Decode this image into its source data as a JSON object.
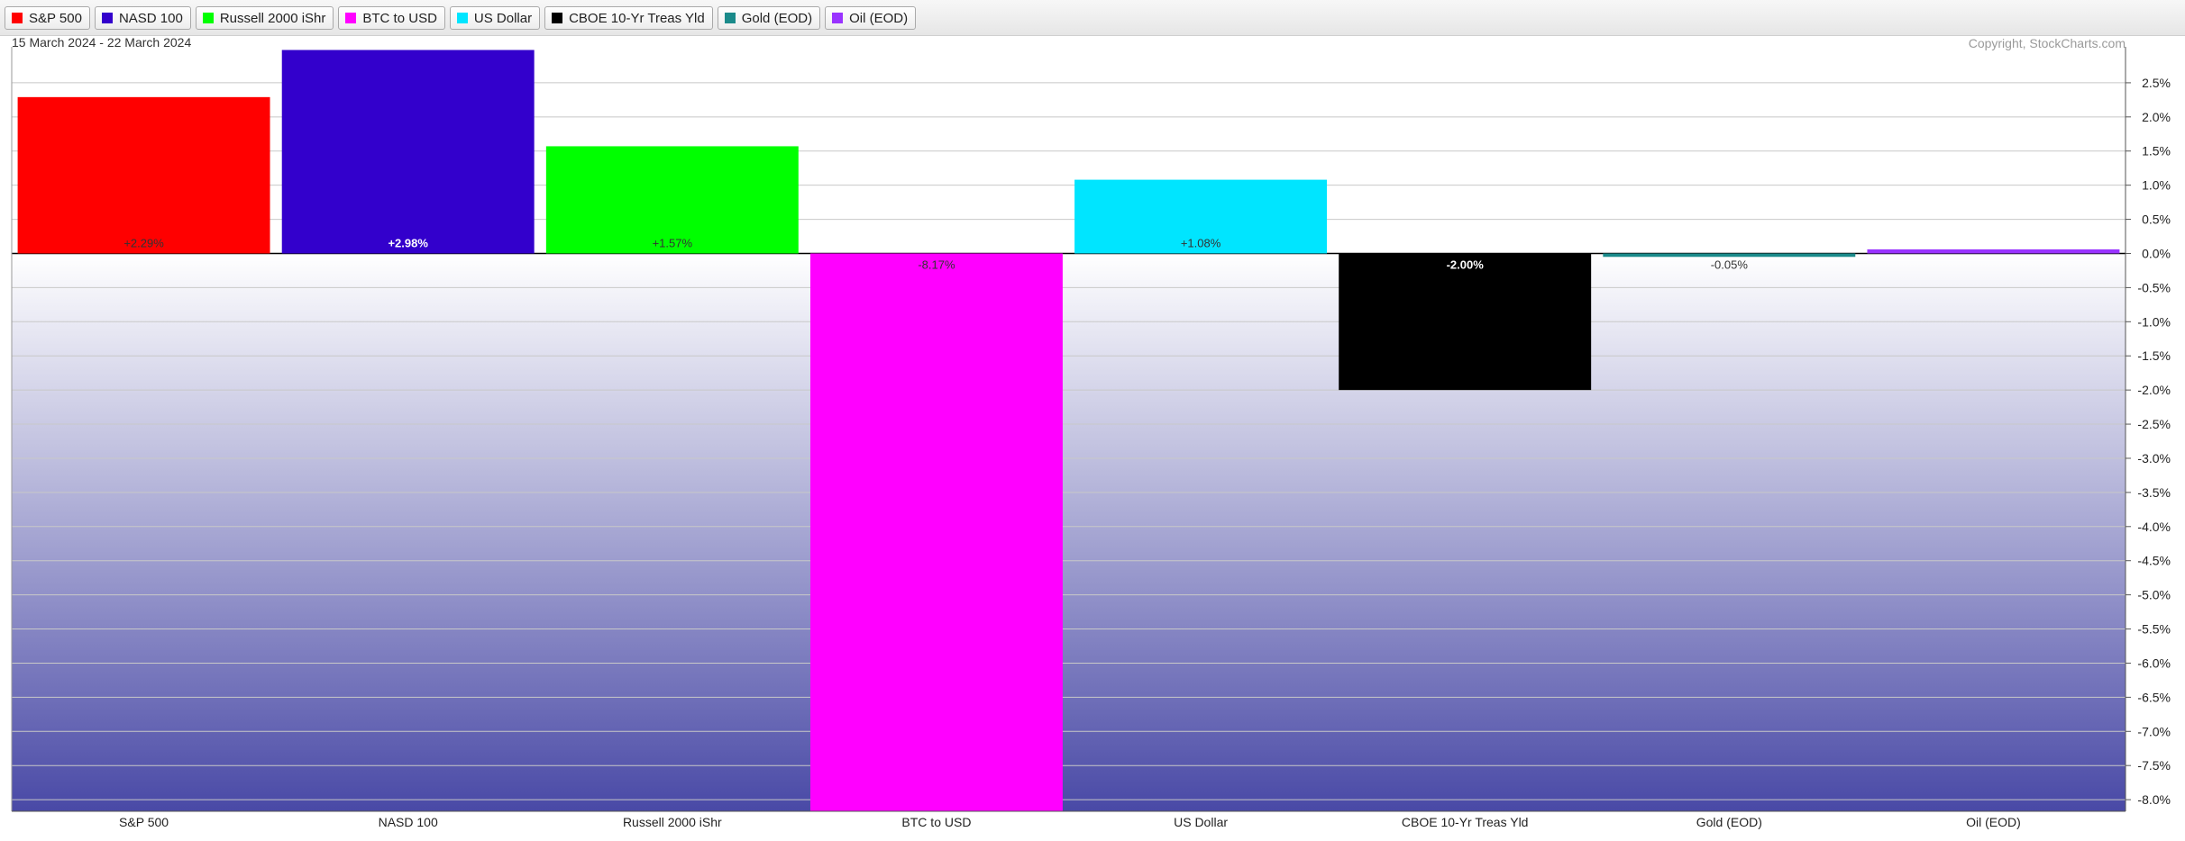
{
  "header": {
    "date_range": "15 March 2024 - 22 March 2024",
    "copyright": "Copyright, StockCharts.com"
  },
  "legend": [
    {
      "label": "S&P 500",
      "color": "#ff0000"
    },
    {
      "label": "NASD 100",
      "color": "#3300cc"
    },
    {
      "label": "Russell 2000 iShr",
      "color": "#00ff00"
    },
    {
      "label": "BTC to USD",
      "color": "#ff00ff"
    },
    {
      "label": "US Dollar",
      "color": "#00e5ff"
    },
    {
      "label": "CBOE 10-Yr Treas Yld",
      "color": "#000000"
    },
    {
      "label": "Gold (EOD)",
      "color": "#1a8a8a"
    },
    {
      "label": "Oil (EOD)",
      "color": "#9933ff"
    }
  ],
  "chart_data": {
    "type": "bar",
    "categories": [
      "S&P 500",
      "NASD 100",
      "Russell 2000 iShr",
      "BTC to USD",
      "US Dollar",
      "CBOE 10-Yr Treas Yld",
      "Gold (EOD)",
      "Oil (EOD)"
    ],
    "values": [
      2.29,
      2.98,
      1.57,
      -8.17,
      1.08,
      -2.0,
      -0.05,
      0.06
    ],
    "value_labels": [
      "+2.29%",
      "+2.98%",
      "+1.57%",
      "-8.17%",
      "+1.08%",
      "-2.00%",
      "-0.05%",
      ""
    ],
    "colors": [
      "#ff0000",
      "#3300cc",
      "#00ff00",
      "#ff00ff",
      "#00e5ff",
      "#000000",
      "#1a8a8a",
      "#9933ff"
    ],
    "y_ticks": [
      2.5,
      2.0,
      1.5,
      1.0,
      0.5,
      0.0,
      -0.5,
      -1.0,
      -1.5,
      -2.0,
      -2.5,
      -3.0,
      -3.5,
      -4.0,
      -4.5,
      -5.0,
      -5.5,
      -6.0,
      -6.5,
      -7.0,
      -7.5,
      -8.0
    ],
    "y_tick_labels": [
      "2.5%",
      "2.0%",
      "1.5%",
      "1.0%",
      "0.5%",
      "0.0%",
      "-0.5%",
      "-1.0%",
      "-1.5%",
      "-2.0%",
      "-2.5%",
      "-3.0%",
      "-3.5%",
      "-4.0%",
      "-4.5%",
      "-5.0%",
      "-5.5%",
      "-6.0%",
      "-6.5%",
      "-7.0%",
      "-7.5%",
      "-8.0%"
    ],
    "ylim": [
      -8.17,
      3.0
    ],
    "grid": true,
    "y_axis_side": "right",
    "legend_position": "top"
  }
}
